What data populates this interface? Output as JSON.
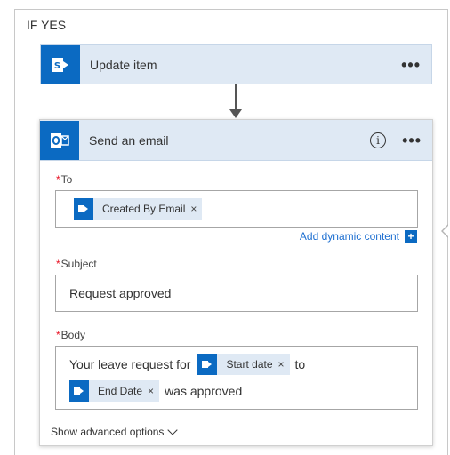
{
  "branch": {
    "label": "IF YES"
  },
  "update_item": {
    "title": "Update item",
    "menu": "•••"
  },
  "email_card": {
    "title": "Send an email",
    "info_glyph": "i",
    "menu": "•••",
    "to": {
      "required_mark": "*",
      "label": "To",
      "tokens": [
        {
          "label": "Created By Email",
          "remove": "×"
        }
      ]
    },
    "add_dynamic_content": "Add dynamic content",
    "add_dynamic_plus": "+",
    "subject": {
      "required_mark": "*",
      "label": "Subject",
      "value": "Request approved"
    },
    "body": {
      "required_mark": "*",
      "label": "Body",
      "line1_text_before": "Your leave request for",
      "token_start": {
        "label": "Start date",
        "remove": "×"
      },
      "line1_text_after": "to",
      "token_end": {
        "label": "End Date",
        "remove": "×"
      },
      "line2_text_after": "was approved"
    },
    "advanced_options": "Show advanced options"
  },
  "colors": {
    "accent": "#0b6ac2",
    "header_bg": "#dfe9f4",
    "link": "#1d6fd1",
    "required": "#e81123"
  }
}
